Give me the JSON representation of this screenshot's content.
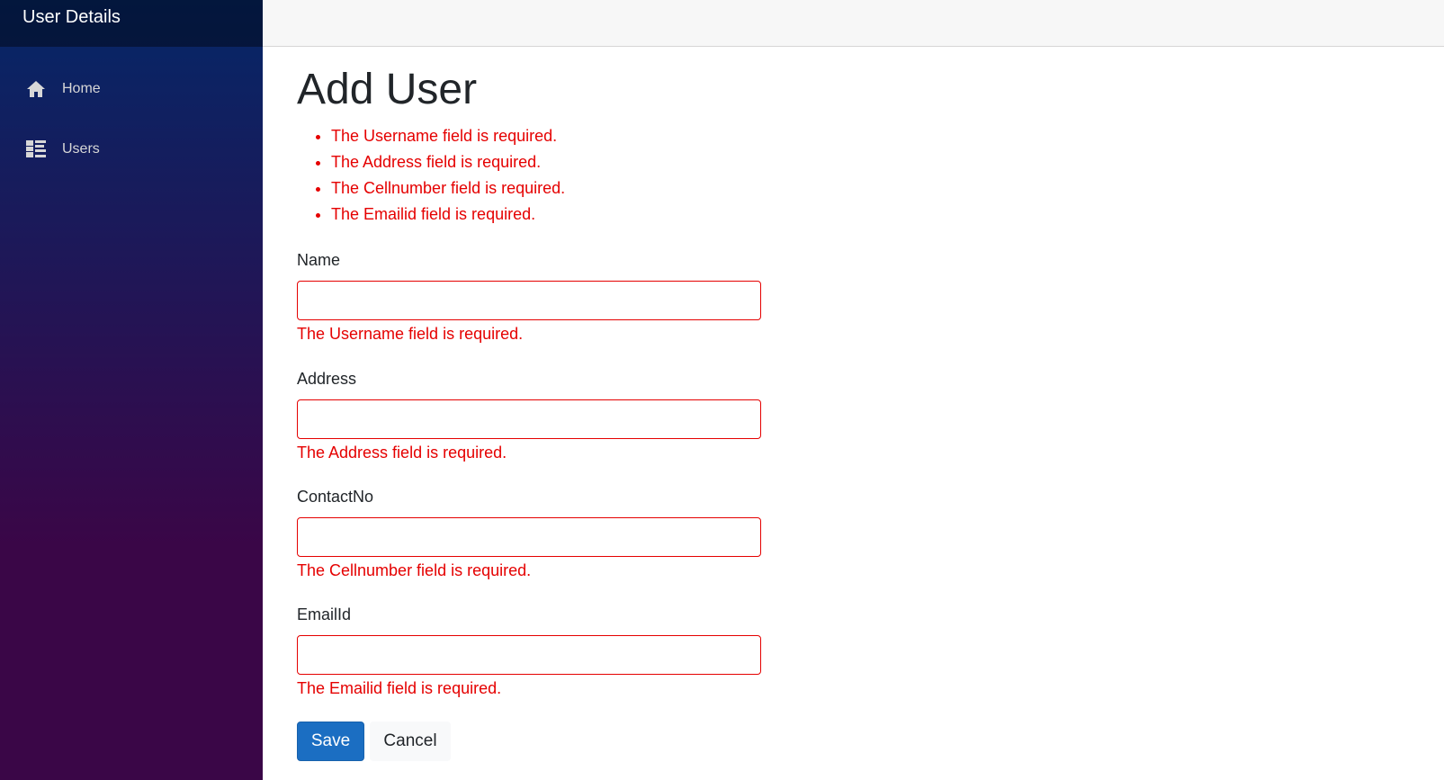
{
  "sidebar": {
    "brand": "User Details",
    "items": [
      {
        "label": "Home",
        "icon": "home-icon"
      },
      {
        "label": "Users",
        "icon": "list-icon"
      }
    ]
  },
  "page": {
    "title": "Add User"
  },
  "validation_summary": [
    "The Username field is required.",
    "The Address field is required.",
    "The Cellnumber field is required.",
    "The Emailid field is required."
  ],
  "form": {
    "fields": [
      {
        "label": "Name",
        "value": "",
        "error": "The Username field is required."
      },
      {
        "label": "Address",
        "value": "",
        "error": "The Address field is required."
      },
      {
        "label": "ContactNo",
        "value": "",
        "error": "The Cellnumber field is required."
      },
      {
        "label": "EmailId",
        "value": "",
        "error": "The Emailid field is required."
      }
    ],
    "save_label": "Save",
    "cancel_label": "Cancel"
  },
  "colors": {
    "error": "#e50000",
    "primary": "#1b6ec2",
    "sidebar_top": "#052767",
    "sidebar_bottom": "#3a0647"
  }
}
